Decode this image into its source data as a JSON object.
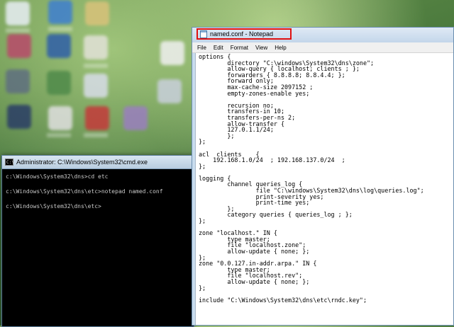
{
  "cmd": {
    "title": "Administrator: C:\\Windows\\System32\\cmd.exe",
    "icon_label": "C:\\",
    "lines": [
      "c:\\Windows\\System32\\dns>cd etc",
      "c:\\Windows\\System32\\dns\\etc>notepad named.conf",
      "c:\\Windows\\System32\\dns\\etc>"
    ]
  },
  "notepad": {
    "title": "named.conf - Notepad",
    "highlight_color": "#e01010",
    "menu": [
      "File",
      "Edit",
      "Format",
      "View",
      "Help"
    ],
    "lines": [
      "options {",
      "        directory \"C:\\windows\\System32\\dns\\zone\";",
      "        allow-query { localhost; clients ; };",
      "        forwarders { 8.8.8.8; 8.8.4.4; };",
      "        forward only;",
      "        max-cache-size 2097152 ;",
      "        empty-zones-enable yes;",
      "",
      "        recursion no;",
      "        transfers-in 10;",
      "        transfers-per-ns 2;",
      "        allow-transfer {",
      "        127.0.1.1/24;",
      "        };",
      "};",
      "",
      "acl  clients    {",
      "    192.168.1.0/24  ; 192.168.137.0/24  ;",
      "};",
      "",
      "logging {",
      "        channel queries_log {",
      "                file \"C:\\windows\\System32\\dns\\log\\queries.log\";",
      "                print-severity yes;",
      "                print-time yes;",
      "        };",
      "        category queries { queries_log ; };",
      "};",
      "",
      "zone \"localhost.\" IN {",
      "        type master;",
      "        file \"localhost.zone\";",
      "        allow-update { none; };",
      "};",
      "zone \"0.0.127.in-addr.arpa.\" IN {",
      "        type master;",
      "        file \"localhost.rev\";",
      "        allow-update { none; };",
      "};",
      "",
      "include \"C:\\Windows\\System32\\dns\\etc\\rndc.key\";"
    ]
  }
}
